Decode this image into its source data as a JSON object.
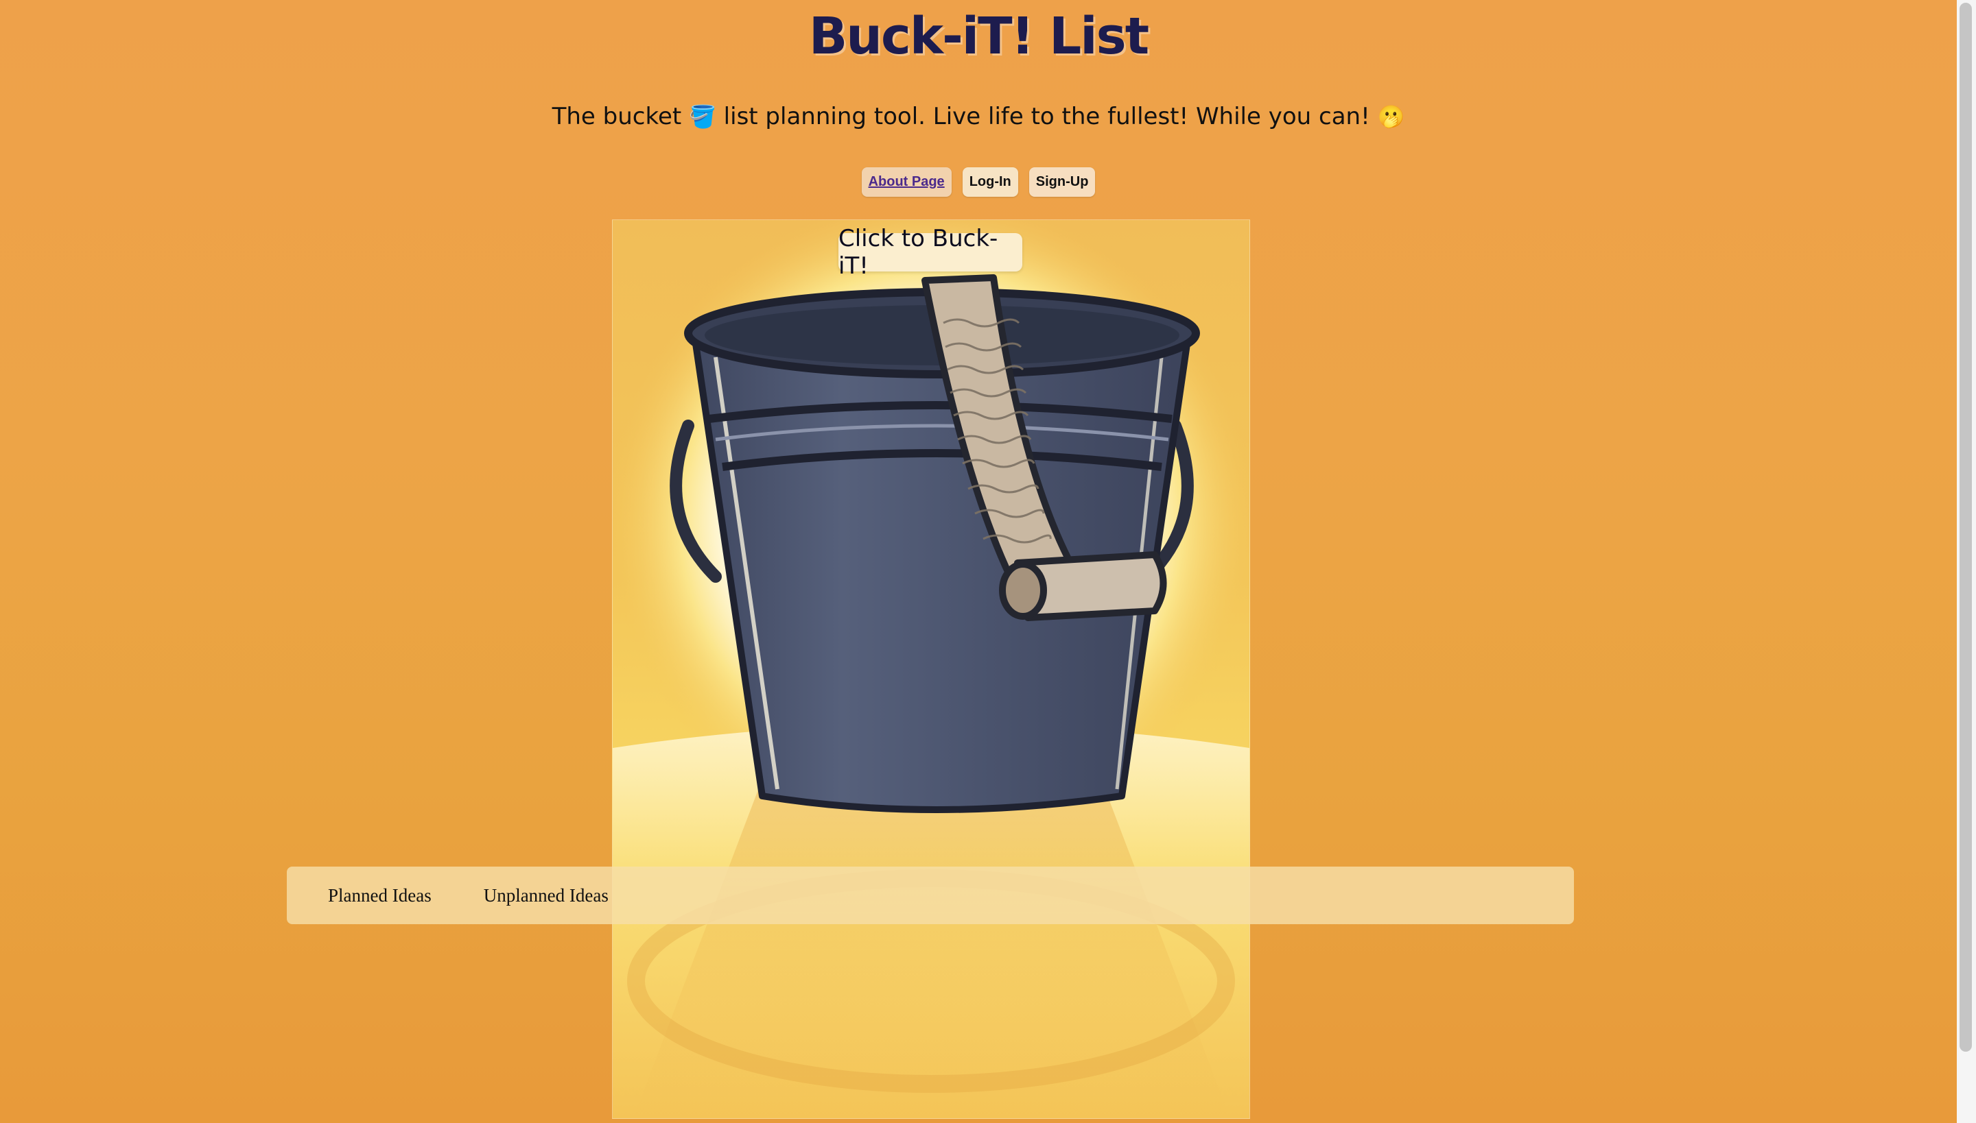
{
  "header": {
    "title": "Buck-iT! List",
    "subtitle_pre": "The bucket",
    "subtitle_emoji": "🪣",
    "subtitle_post": "list planning tool. Live life to the fullest! While you can!",
    "subtitle_end_emoji": "🫢"
  },
  "nav": {
    "about_label": "About Page",
    "login_label": "Log-In",
    "signup_label": "Sign-Up"
  },
  "hero": {
    "cta_label": "Click to Buck-iT!"
  },
  "tabs": {
    "planned_label": "Planned Ideas",
    "unplanned_label": "Unplanned Ideas"
  },
  "colors": {
    "background": "#eda447",
    "title": "#1d1c4e",
    "bucket": "#475069",
    "scroll": "#c9b9a5"
  },
  "icons": [
    "bucket-icon",
    "hushed-face-icon"
  ]
}
